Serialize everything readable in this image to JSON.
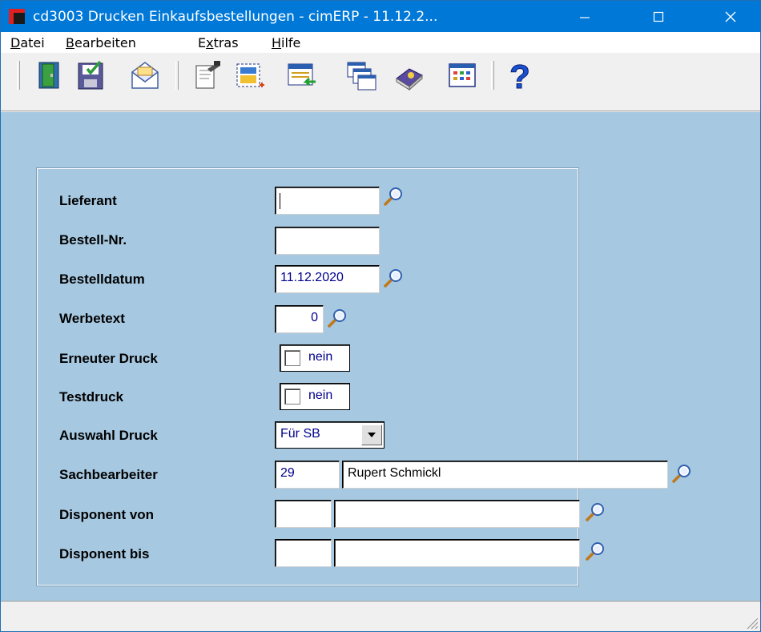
{
  "window": {
    "title": "cd3003 Drucken Einkaufsbestellungen - cimERP - 11.12.2...",
    "minimize_glyph": "—",
    "maximize_glyph": "☐",
    "close_glyph": "✕"
  },
  "menu": {
    "items": [
      {
        "accel": "D",
        "rest": "atei"
      },
      {
        "accel": "B",
        "rest": "earbeiten"
      },
      {
        "pre": "E",
        "accel": "x",
        "rest": "tras"
      },
      {
        "accel": "H",
        "rest": "ilfe"
      }
    ]
  },
  "toolbar": {
    "icons": [
      "exit-door-icon",
      "save-icon",
      "mail-icon",
      "print-preview-icon",
      "new-selection-icon",
      "transfer-icon",
      "windows-icon",
      "book-icon",
      "table-icon",
      "help-icon"
    ]
  },
  "form": {
    "lieferant": {
      "label": "Lieferant",
      "value": ""
    },
    "bestell_nr": {
      "label": "Bestell-Nr.",
      "value": ""
    },
    "bestelldatum": {
      "label": "Bestelldatum",
      "value": "11.12.2020"
    },
    "werbetext": {
      "label": "Werbetext",
      "value": "0"
    },
    "erneuter_druck": {
      "label": "Erneuter Druck",
      "value": "nein"
    },
    "testdruck": {
      "label": "Testdruck",
      "value": "nein"
    },
    "auswahl_druck": {
      "label": "Auswahl Druck",
      "value": "Für SB"
    },
    "sachbearbeiter": {
      "label": "Sachbearbeiter",
      "code": "29",
      "name": "Rupert Schmickl"
    },
    "disponent_von": {
      "label": "Disponent von",
      "code": "",
      "name": ""
    },
    "disponent_bis": {
      "label": "Disponent bis",
      "code": "",
      "name": ""
    }
  },
  "colors": {
    "titlebar": "#0078d7",
    "content_bg": "#a6c8e0",
    "value_text": "#00008b"
  }
}
